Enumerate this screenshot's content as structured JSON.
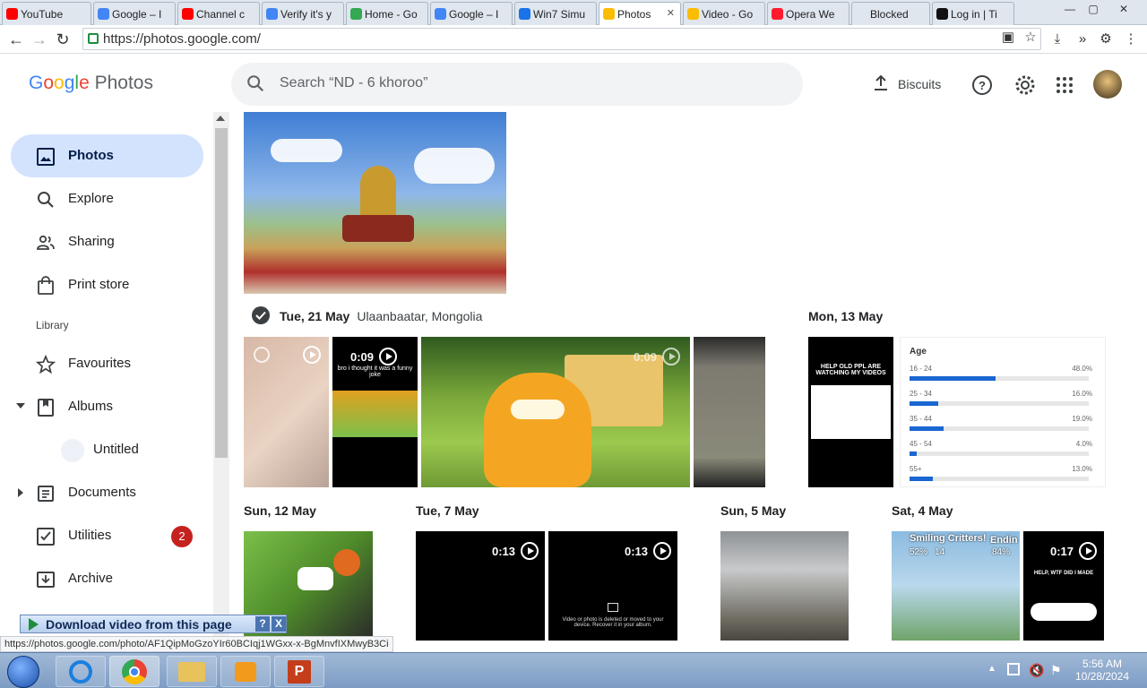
{
  "browser": {
    "tabs": [
      {
        "label": "YouTube",
        "favicon_color": "#ff0000"
      },
      {
        "label": "Google – I",
        "favicon_color": "#4285f4"
      },
      {
        "label": "Channel c",
        "favicon_color": "#ff0000"
      },
      {
        "label": "Verify it's y",
        "favicon_color": "#4285f4"
      },
      {
        "label": "Home - Go",
        "favicon_color": "#34a853"
      },
      {
        "label": "Google – I",
        "favicon_color": "#4285f4"
      },
      {
        "label": "Win7 Simu",
        "favicon_color": "#1a73e8"
      },
      {
        "label": "Photos",
        "favicon_color": "#fbbc04"
      },
      {
        "label": "Video - Go",
        "favicon_color": "#fbbc04"
      },
      {
        "label": "Opera We",
        "favicon_color": "#ff1b2d"
      },
      {
        "label": "Blocked",
        "favicon_color": "#dfe6ee"
      },
      {
        "label": "Log in | Ti",
        "favicon_color": "#111111"
      }
    ],
    "url": "https://photos.google.com/",
    "status_url": "https://photos.google.com/photo/AF1QipMoGzoYIr60BCIqj1WGxx-x-BgMnvfIXMwyB3Ci"
  },
  "app": {
    "logo_google": "Google",
    "logo_photos": "Photos",
    "search_placeholder": "Search “ND - 6 khoroo”",
    "upload_label": "Biscuits"
  },
  "sidebar": {
    "items": [
      {
        "label": "Photos",
        "icon": "photo-icon",
        "active": true
      },
      {
        "label": "Explore",
        "icon": "search-icon"
      },
      {
        "label": "Sharing",
        "icon": "people-icon"
      },
      {
        "label": "Print store",
        "icon": "bag-icon"
      }
    ],
    "library_label": "Library",
    "library_items": [
      {
        "label": "Favourites",
        "icon": "star-icon"
      },
      {
        "label": "Albums",
        "icon": "album-icon"
      },
      {
        "label": "Untitled",
        "icon": "album-thumb"
      },
      {
        "label": "Documents",
        "icon": "document-icon"
      },
      {
        "label": "Utilities",
        "icon": "checklist-icon",
        "badge": "2"
      },
      {
        "label": "Archive",
        "icon": "archive-icon"
      }
    ]
  },
  "content": {
    "sections": [
      {
        "date": "Tue, 21 May",
        "location": "Ulaanbaatar, Mongolia"
      },
      {
        "date": "Mon, 13 May"
      },
      {
        "date": "Sun, 12 May"
      },
      {
        "date": "Tue, 7 May"
      },
      {
        "date": "Sun, 5 May"
      },
      {
        "date": "Sat, 4 May"
      }
    ],
    "video_durations": [
      "0:09",
      "0:09",
      "0:13",
      "0:13",
      "0:17"
    ],
    "tiktok_caption_1": "bro i thought it was a funny joke",
    "tiktok_caption_2": "HELP OLD PPL ARE WATCHING MY VIDEOS",
    "tiktok_caption_3": "HELP, WTF DID I MADE",
    "deleted_text": "Video or photo is deleted or moved to your device. Recover it in your album.",
    "age_chart": {
      "title": "Age",
      "rows": [
        {
          "range": "16 - 24",
          "value": "48.0%",
          "fraction": 0.48
        },
        {
          "range": "25 - 34",
          "value": "16.0%",
          "fraction": 0.16
        },
        {
          "range": "35 - 44",
          "value": "19.0%",
          "fraction": 0.19
        },
        {
          "range": "45 - 54",
          "value": "4.0%",
          "fraction": 0.04
        },
        {
          "range": "55+",
          "value": "13.0%",
          "fraction": 0.13
        }
      ]
    },
    "critters_title": "Smiling Critters!",
    "critters_stats": [
      "52%",
      "14",
      "84%"
    ],
    "critters_side": "Endin"
  },
  "download_bar": {
    "label": "Download video from this page",
    "help": "?",
    "close": "X"
  },
  "taskbar": {
    "time": "5:56 AM",
    "date": "10/28/2024"
  }
}
